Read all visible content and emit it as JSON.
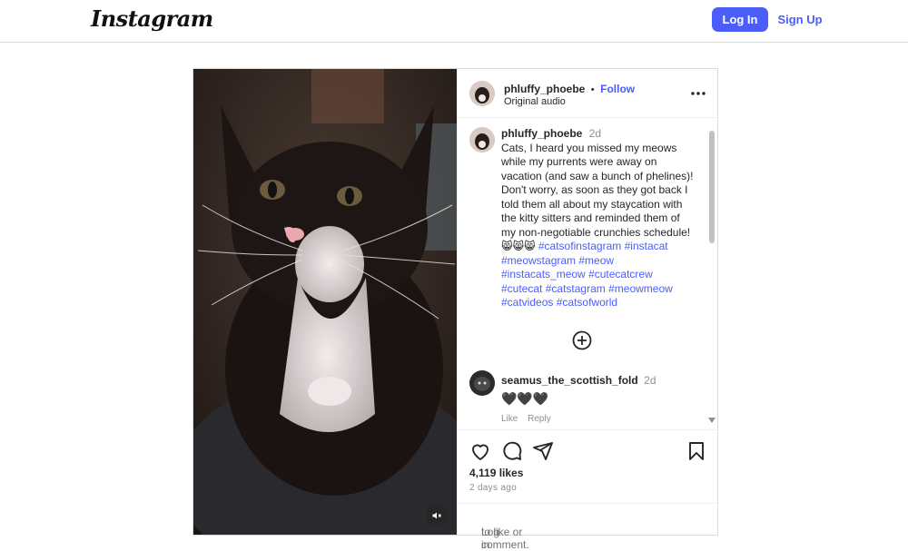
{
  "brand": {
    "logo": "Instagram"
  },
  "header": {
    "login_label": "Log In",
    "signup_label": "Sign Up"
  },
  "post": {
    "author": "phluffy_phoebe",
    "separator": "•",
    "follow_label": "Follow",
    "audio": "Original audio",
    "caption": {
      "author": "phluffy_phoebe",
      "time": "2d",
      "text": "Cats, I heard you missed my meows while my purrents were away on vacation (and saw a bunch of phelines)! Don't worry, as soon as they got back I told them all about my staycation with the kitty sitters and reminded them of my non-negotiable crunchies schedule! 😸😸😸 ",
      "hashtags": [
        "#catsofinstagram",
        "#instacat",
        "#meowstagram",
        "#meow",
        "#instacats_meow",
        "#cutecatcrew",
        "#cutecat",
        "#catstagram",
        "#meowmeow",
        "#catvideos",
        "#catsofworld"
      ]
    },
    "comment": {
      "author": "seamus_the_scottish_fold",
      "time": "2d",
      "text": "🖤🖤🖤",
      "like_label": "Like",
      "reply_label": "Reply"
    },
    "likes": "4,119 likes",
    "posted": "2 days ago",
    "login_prompt": {
      "link": "Log in",
      "rest": " to like or comment."
    }
  },
  "icons": [
    "like-icon",
    "comment-icon",
    "share-icon",
    "save-icon",
    "more-icon",
    "load-more-icon",
    "mute-icon"
  ],
  "colors": {
    "accent": "#4a5df9",
    "text": "#262626",
    "muted": "#8e8e8e",
    "border": "#dbdbdb"
  }
}
